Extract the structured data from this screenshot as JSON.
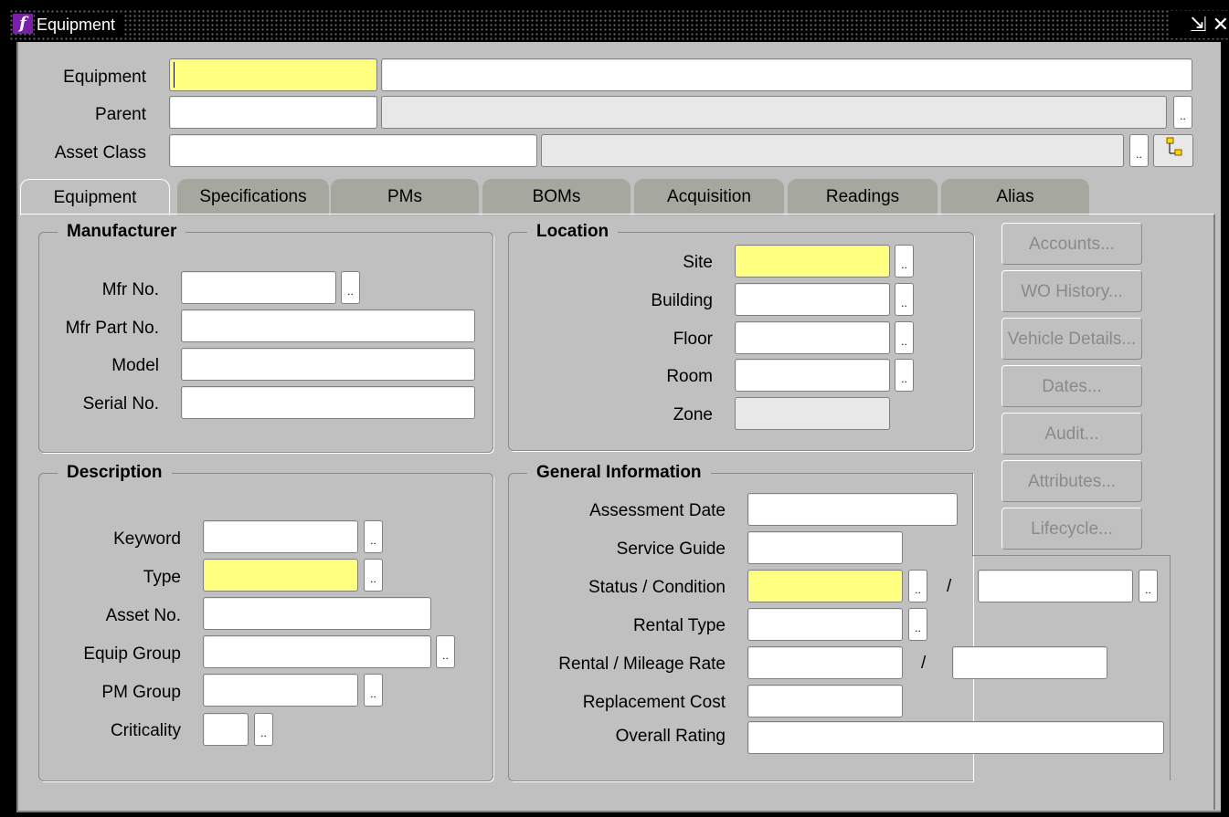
{
  "window": {
    "title": "Equipment",
    "minimize": "⇲",
    "close": "✕"
  },
  "header": {
    "equipment_label": "Equipment",
    "parent_label": "Parent",
    "asset_class_label": "Asset Class"
  },
  "lov_glyph": "..",
  "tabs": [
    "Equipment",
    "Specifications",
    "PMs",
    "BOMs",
    "Acquisition",
    "Readings",
    "Alias"
  ],
  "manufacturer": {
    "title": "Manufacturer",
    "mfr_no": "Mfr No.",
    "mfr_part_no": "Mfr Part No.",
    "model": "Model",
    "serial_no": "Serial No."
  },
  "location": {
    "title": "Location",
    "site": "Site",
    "building": "Building",
    "floor": "Floor",
    "room": "Room",
    "zone": "Zone"
  },
  "description": {
    "title": "Description",
    "keyword": "Keyword",
    "type": "Type",
    "asset_no": "Asset No.",
    "equip_group": "Equip Group",
    "pm_group": "PM Group",
    "criticality": "Criticality"
  },
  "general": {
    "title": "General Information",
    "assessment_date": "Assessment Date",
    "service_guide": "Service Guide",
    "status_condition": "Status / Condition",
    "rental_type": "Rental Type",
    "rental_mileage": "Rental / Mileage Rate",
    "replacement_cost": "Replacement Cost",
    "overall_rating": "Overall Rating",
    "slash": "/"
  },
  "side_buttons": [
    "Accounts...",
    "WO History...",
    "Vehicle Details...",
    "Dates...",
    "Audit...",
    "Attributes...",
    "Lifecycle..."
  ]
}
